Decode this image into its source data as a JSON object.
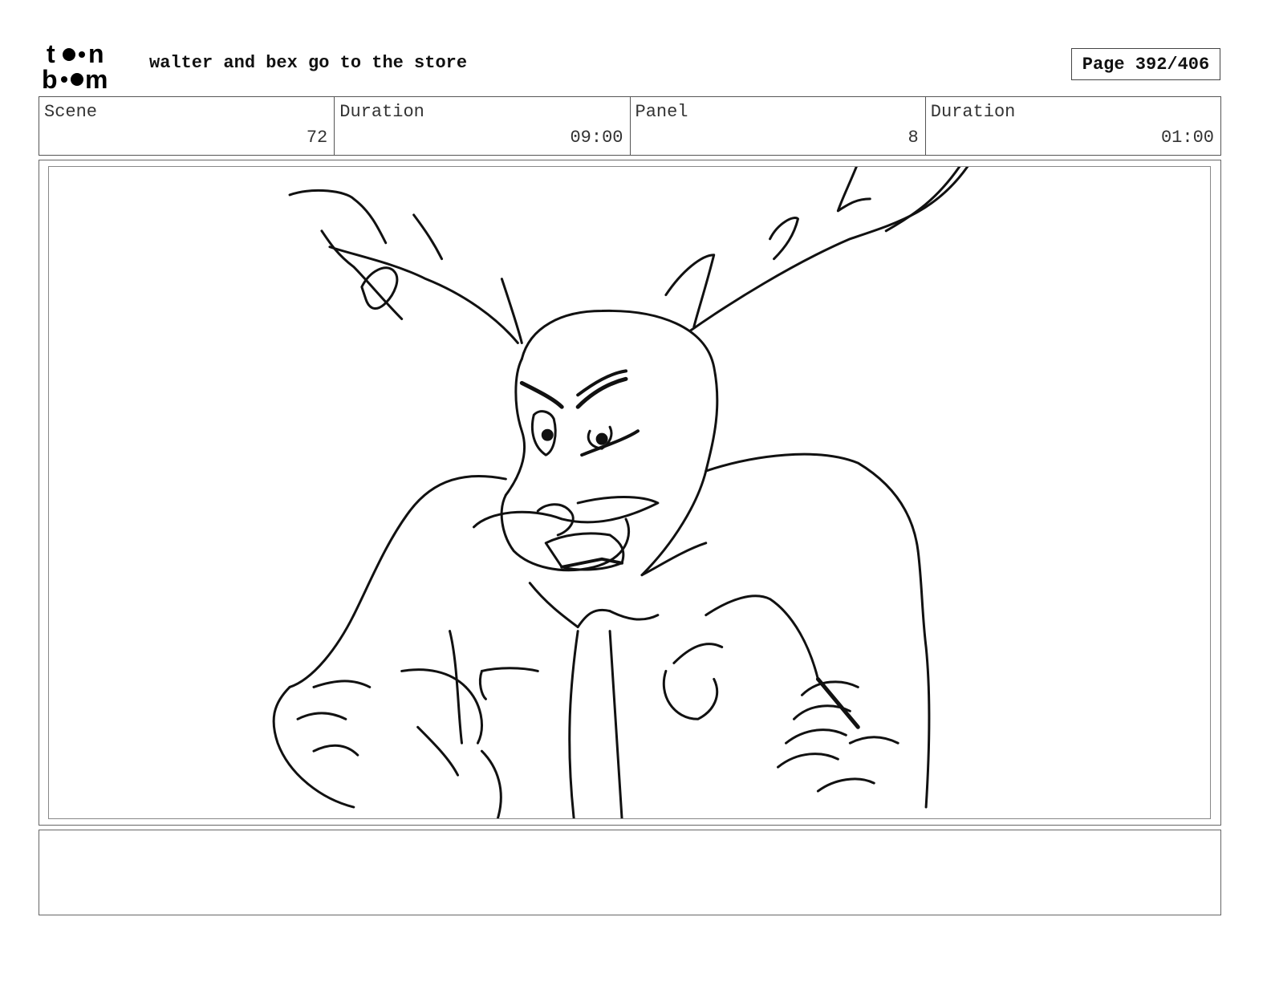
{
  "header": {
    "logo_text_top": "toon",
    "logo_text_bottom": "boom",
    "title": "walter and bex go to the store",
    "page_label": "Page 392/406"
  },
  "info": [
    {
      "label": "Scene",
      "value": "72"
    },
    {
      "label": "Duration",
      "value": "09:00"
    },
    {
      "label": "Panel",
      "value": "8"
    },
    {
      "label": "Duration",
      "value": "01:00"
    }
  ],
  "panel": {
    "sketch_icon": "antlered-character-sketch",
    "stroke_color": "#111111"
  },
  "notes": {
    "text": ""
  }
}
